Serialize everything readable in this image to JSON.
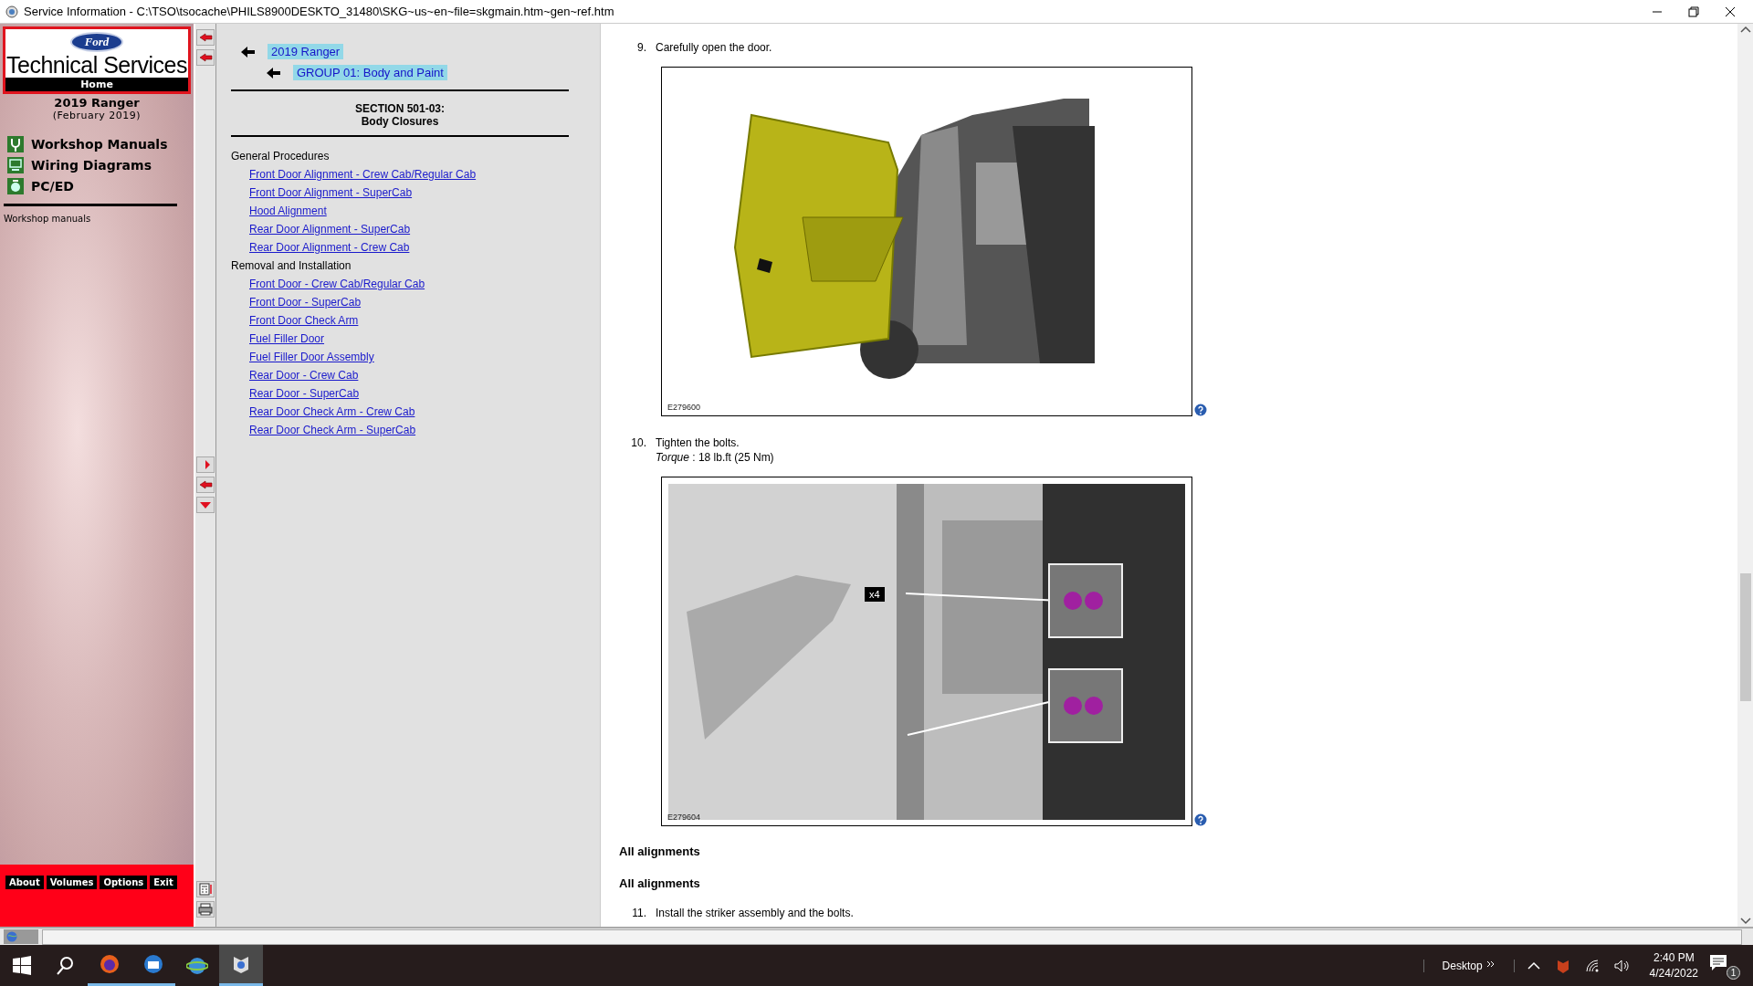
{
  "window": {
    "title": "Service Information - C:\\TSO\\tsocache\\PHILS8900DESKTO_31480\\SKG~us~en~file=skgmain.htm~gen~ref.htm"
  },
  "sidebar": {
    "brand": "Ford",
    "title": "Technical Services",
    "home": "Home",
    "model": "2019 Ranger",
    "date": "(February 2019)",
    "items": [
      {
        "label": "Workshop Manuals"
      },
      {
        "label": "Wiring Diagrams"
      },
      {
        "label": "PC/ED"
      }
    ],
    "section_label": "Workshop manuals",
    "buttons": [
      "About",
      "Volumes",
      "Options",
      "Exit"
    ]
  },
  "nav": {
    "breadcrumbs": [
      "2019 Ranger",
      "GROUP 01: Body and Paint"
    ],
    "section": "SECTION 501-03:",
    "section_title": "Body Closures",
    "groups": [
      {
        "heading": "General Procedures",
        "links": [
          "Front Door Alignment - Crew Cab/Regular Cab",
          "Front Door Alignment - SuperCab",
          "Hood Alignment",
          "Rear Door Alignment - SuperCab",
          "Rear Door Alignment - Crew Cab"
        ]
      },
      {
        "heading": "Removal and Installation",
        "links": [
          "Front Door - Crew Cab/Regular Cab",
          "Front Door - SuperCab",
          "Front Door Check Arm",
          "Fuel Filler Door",
          "Fuel Filler Door Assembly",
          "Rear Door - Crew Cab",
          "Rear Door - SuperCab",
          "Rear Door Check Arm - Crew Cab",
          "Rear Door Check Arm - SuperCab"
        ]
      }
    ]
  },
  "content": {
    "steps": [
      {
        "number": "9.",
        "text": "Carefully open the door.",
        "figure": {
          "kind": "open-door",
          "code": "E279600"
        }
      },
      {
        "number": "10.",
        "text": "Tighten the bolts.",
        "torque": "*Torque* : 18 lb.ft (25 Nm)",
        "figure": {
          "kind": "hinge-bolts",
          "code": "E279604",
          "callout": "x4"
        }
      }
    ],
    "headings": [
      "All alignments",
      "All alignments"
    ],
    "next_step": {
      "number": "11.",
      "text": "Install the striker assembly and the bolts."
    }
  },
  "taskbar": {
    "desktop": "Desktop",
    "time": "2:40 PM",
    "date": "4/24/2022",
    "notifications": "1"
  }
}
